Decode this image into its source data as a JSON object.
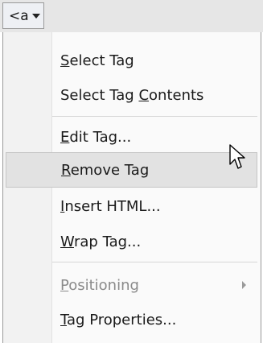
{
  "tag_selector": {
    "label": "<a",
    "caret": "dropdown-caret-icon"
  },
  "menu": {
    "items": [
      {
        "label": "Select Tag",
        "access_key": "S",
        "rest": "elect Tag"
      },
      {
        "label": "Select Tag Contents",
        "pre": "Select Tag ",
        "access_key": "C",
        "rest": "ontents"
      },
      {
        "label": "Edit Tag...",
        "access_key": "E",
        "rest": "dit Tag..."
      },
      {
        "label": "Remove Tag",
        "access_key": "R",
        "rest": "emove Tag",
        "state": "hover"
      },
      {
        "label": "Insert HTML...",
        "access_key": "I",
        "rest": "nsert HTML..."
      },
      {
        "label": "Wrap Tag...",
        "access_key": "W",
        "rest": "rap Tag..."
      },
      {
        "label": "Positioning",
        "access_key": "P",
        "rest": "ositioning",
        "state": "disabled",
        "submenu": "chevron-right-icon"
      },
      {
        "label": "Tag Properties...",
        "access_key": "T",
        "rest": "ag Properties..."
      }
    ]
  },
  "cursor": "mouse-pointer-icon"
}
